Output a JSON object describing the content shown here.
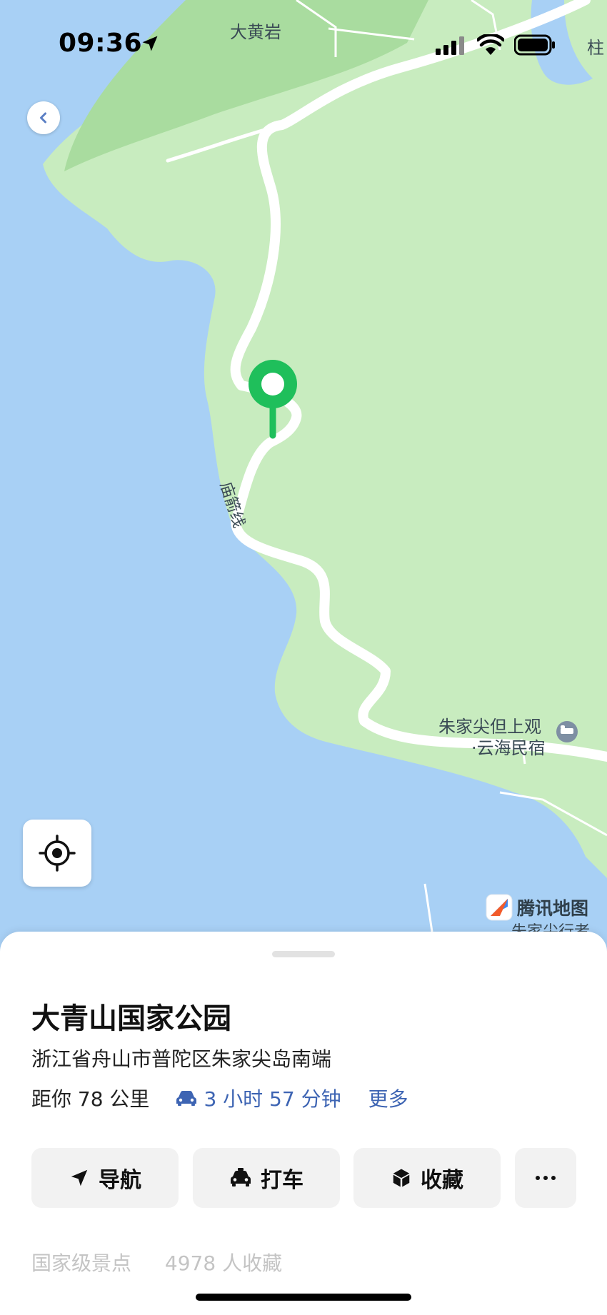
{
  "status_bar": {
    "time": "09:36"
  },
  "map": {
    "labels": {
      "top_place": "大黄岩",
      "top_right": "柱",
      "road": "庙箭线",
      "hotel_line1": "朱家尖但上观",
      "hotel_line2": "·云海民宿",
      "bottom_right": "朱家尖行者"
    },
    "brand": "腾讯地图",
    "colors": {
      "water": "#a8d0f5",
      "land": "#c8ecbf",
      "pin": "#1fbf5b"
    }
  },
  "place": {
    "name": "大青山国家公园",
    "address": "浙江省舟山市普陀区朱家尖岛南端",
    "distance": "距你 78 公里",
    "drive_time": "3 小时 57 分钟",
    "more": "更多",
    "category": "国家级景点",
    "favorites": "4978 人收藏"
  },
  "actions": {
    "navigate": "导航",
    "taxi": "打车",
    "favorite": "收藏",
    "more_icon": "ellipsis-icon"
  }
}
